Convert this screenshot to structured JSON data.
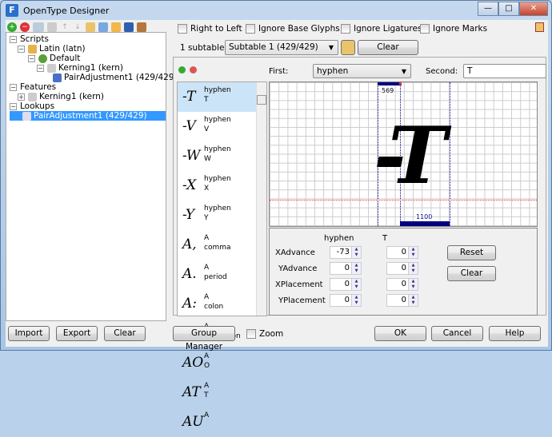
{
  "window": {
    "title": "OpenType Designer",
    "icon_letter": "F",
    "min": "—",
    "max": "□",
    "close": "✕"
  },
  "tree": {
    "scripts": "Scripts",
    "latin": "Latin (latn)",
    "default": "Default",
    "kerning_s": "Kerning1 (kern)",
    "pair_s": "PairAdjustment1 (429/429)",
    "features": "Features",
    "kerning_f": "Kerning1 (kern)",
    "lookups": "Lookups",
    "pair_l": "PairAdjustment1 (429/429)"
  },
  "options": {
    "rtl": "Right to Left",
    "base": "Ignore Base Glyphs",
    "lig": "Ignore Ligatures",
    "marks": "Ignore Marks"
  },
  "subtables": {
    "count": "1 subtables",
    "selected": "Subtable 1 (429/429)",
    "clear": "Clear Subtable"
  },
  "pair": {
    "first_label": "First:",
    "first": "hyphen",
    "second_label": "Second:",
    "second": "T"
  },
  "pairs": [
    {
      "g": "-T",
      "a": "hyphen",
      "b": "T"
    },
    {
      "g": "-V",
      "a": "hyphen",
      "b": "V"
    },
    {
      "g": "-W",
      "a": "hyphen",
      "b": "W"
    },
    {
      "g": "-X",
      "a": "hyphen",
      "b": "X"
    },
    {
      "g": "-Y",
      "a": "hyphen",
      "b": "Y"
    },
    {
      "g": "A,",
      "a": "A",
      "b": "comma"
    },
    {
      "g": "A.",
      "a": "A",
      "b": "period"
    },
    {
      "g": "A:",
      "a": "A",
      "b": "colon"
    },
    {
      "g": "A;",
      "a": "A",
      "b": "semicolon"
    },
    {
      "g": "AO",
      "a": "A",
      "b": "O"
    },
    {
      "g": "AT",
      "a": "A",
      "b": "T"
    },
    {
      "g": "AU",
      "a": "A",
      "b": ""
    }
  ],
  "preview": {
    "glyph": "-T",
    "first_width": "569",
    "second_width": "1100"
  },
  "values": {
    "col1": "hyphen",
    "col2": "T",
    "rows": [
      {
        "label": "XAdvance",
        "a": "-73",
        "b": "0"
      },
      {
        "label": "YAdvance",
        "a": "0",
        "b": "0"
      },
      {
        "label": "XPlacement",
        "a": "0",
        "b": "0"
      },
      {
        "label": "YPlacement",
        "a": "0",
        "b": "0"
      }
    ],
    "reset": "Reset",
    "clear": "Clear"
  },
  "bottom": {
    "import": "Import",
    "export": "Export",
    "clear": "Clear",
    "group": "Group Manager",
    "zoom": "Zoom",
    "ok": "OK",
    "cancel": "Cancel",
    "help": "Help"
  },
  "colors": {
    "selection": "#3399ff",
    "metric_bar": "#000080",
    "baseline": "#ff0000"
  }
}
